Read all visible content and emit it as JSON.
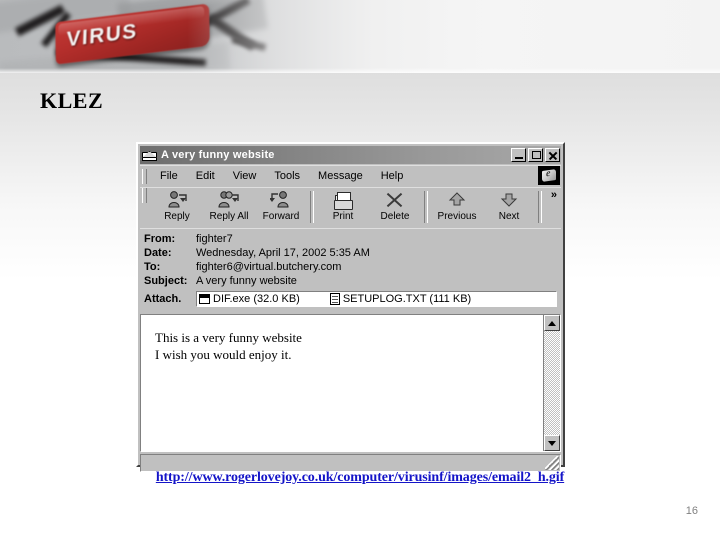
{
  "slide": {
    "title": "KLEZ",
    "banner_key_label": "VIRUS",
    "caption_url": "http://www.rogerlovejoy.co.uk/computer/virusinf/images/email2_h.gif",
    "page_number": "16"
  },
  "window": {
    "title": "A very  funny website",
    "icon": "envelope-icon",
    "controls": {
      "minimize": "_",
      "maximize": "□",
      "close": "✕"
    },
    "menu": [
      {
        "label": "File"
      },
      {
        "label": "Edit"
      },
      {
        "label": "View"
      },
      {
        "label": "Tools"
      },
      {
        "label": "Message"
      },
      {
        "label": "Help"
      }
    ],
    "toolbar": {
      "overflow": "»",
      "buttons": [
        {
          "label": "Reply",
          "icon": "reply-icon"
        },
        {
          "label": "Reply All",
          "icon": "reply-all-icon"
        },
        {
          "label": "Forward",
          "icon": "forward-icon"
        },
        {
          "label": "Print",
          "icon": "printer-icon"
        },
        {
          "label": "Delete",
          "icon": "delete-x-icon"
        },
        {
          "label": "Previous",
          "icon": "arrow-up-icon"
        },
        {
          "label": "Next",
          "icon": "arrow-down-icon"
        }
      ]
    },
    "headers": {
      "from_label": "From:",
      "from_value": "fighter7",
      "date_label": "Date:",
      "date_value": "Wednesday, April 17, 2002 5:35 AM",
      "to_label": "To:",
      "to_value": "fighter6@virtual.butchery.com",
      "subject_label": "Subject:",
      "subject_value": "A very  funny website",
      "attach_label": "Attach.",
      "attachments": [
        {
          "name": "DIF.exe (32.0 KB)",
          "icon": "exe-file-icon"
        },
        {
          "name": "SETUPLOG.TXT (111 KB)",
          "icon": "text-file-icon"
        }
      ]
    },
    "message_body": {
      "line1": "This is a very funny website",
      "line2": "I wish you would enjoy it."
    },
    "scrollbar": {
      "up": "▲",
      "down": "▼"
    },
    "statusbar_text": ""
  },
  "colors": {
    "window_face": "#c0c0c0",
    "titlebar": "#8a8a8a",
    "link": "#1414c8",
    "key_red": "#b52f2c"
  }
}
